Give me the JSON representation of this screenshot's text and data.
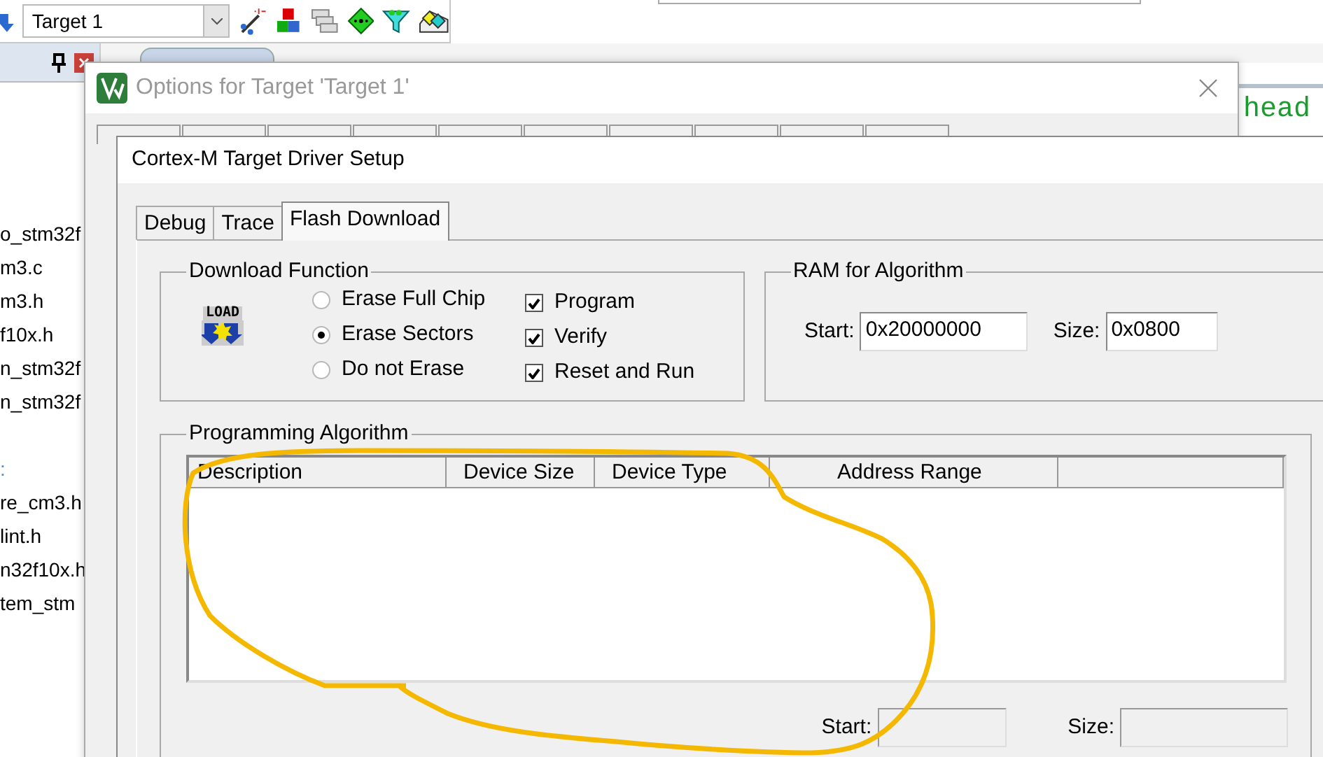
{
  "toolbar": {
    "target_select": "Target 1"
  },
  "project_panel": {
    "files": [
      {
        "name": "o_stm32f",
        "kind": "file"
      },
      {
        "name": "m3.c",
        "kind": "file"
      },
      {
        "name": "m3.h",
        "kind": "file"
      },
      {
        "name": "f10x.h",
        "kind": "file"
      },
      {
        "name": "n_stm32f",
        "kind": "file"
      },
      {
        "name": "n_stm32f",
        "kind": "file"
      },
      {
        "name": ":",
        "kind": "group"
      },
      {
        "name": "re_cm3.h",
        "kind": "file"
      },
      {
        "name": "lint.h",
        "kind": "file"
      },
      {
        "name": "n32f10x.h",
        "kind": "file"
      },
      {
        "name": "tem_stm",
        "kind": "file"
      }
    ]
  },
  "editor": {
    "code_text": "head"
  },
  "options_dialog": {
    "title": "Options for Target 'Target 1'"
  },
  "driver_setup": {
    "title": "Cortex-M Target Driver Setup",
    "tabs": [
      {
        "label": "Debug",
        "selected": false
      },
      {
        "label": "Trace",
        "selected": false
      },
      {
        "label": "Flash Download",
        "selected": true
      }
    ],
    "download_function": {
      "title": "Download Function",
      "icon_label": "LOAD",
      "erase_options": [
        {
          "label": "Erase Full Chip",
          "selected": false
        },
        {
          "label": "Erase Sectors",
          "selected": true
        },
        {
          "label": "Do not Erase",
          "selected": false
        }
      ],
      "options": [
        {
          "label": "Program",
          "checked": true
        },
        {
          "label": "Verify",
          "checked": true
        },
        {
          "label": "Reset and Run",
          "checked": true
        }
      ]
    },
    "ram_for_algorithm": {
      "title": "RAM for Algorithm",
      "start_label": "Start:",
      "start": "0x20000000",
      "size_label": "Size:",
      "size": "0x0800"
    },
    "programming_algorithm": {
      "title": "Programming Algorithm",
      "columns": [
        "Description",
        "Device Size",
        "Device Type",
        "Address Range"
      ],
      "start_label": "Start:",
      "size_label": "Size:"
    }
  }
}
